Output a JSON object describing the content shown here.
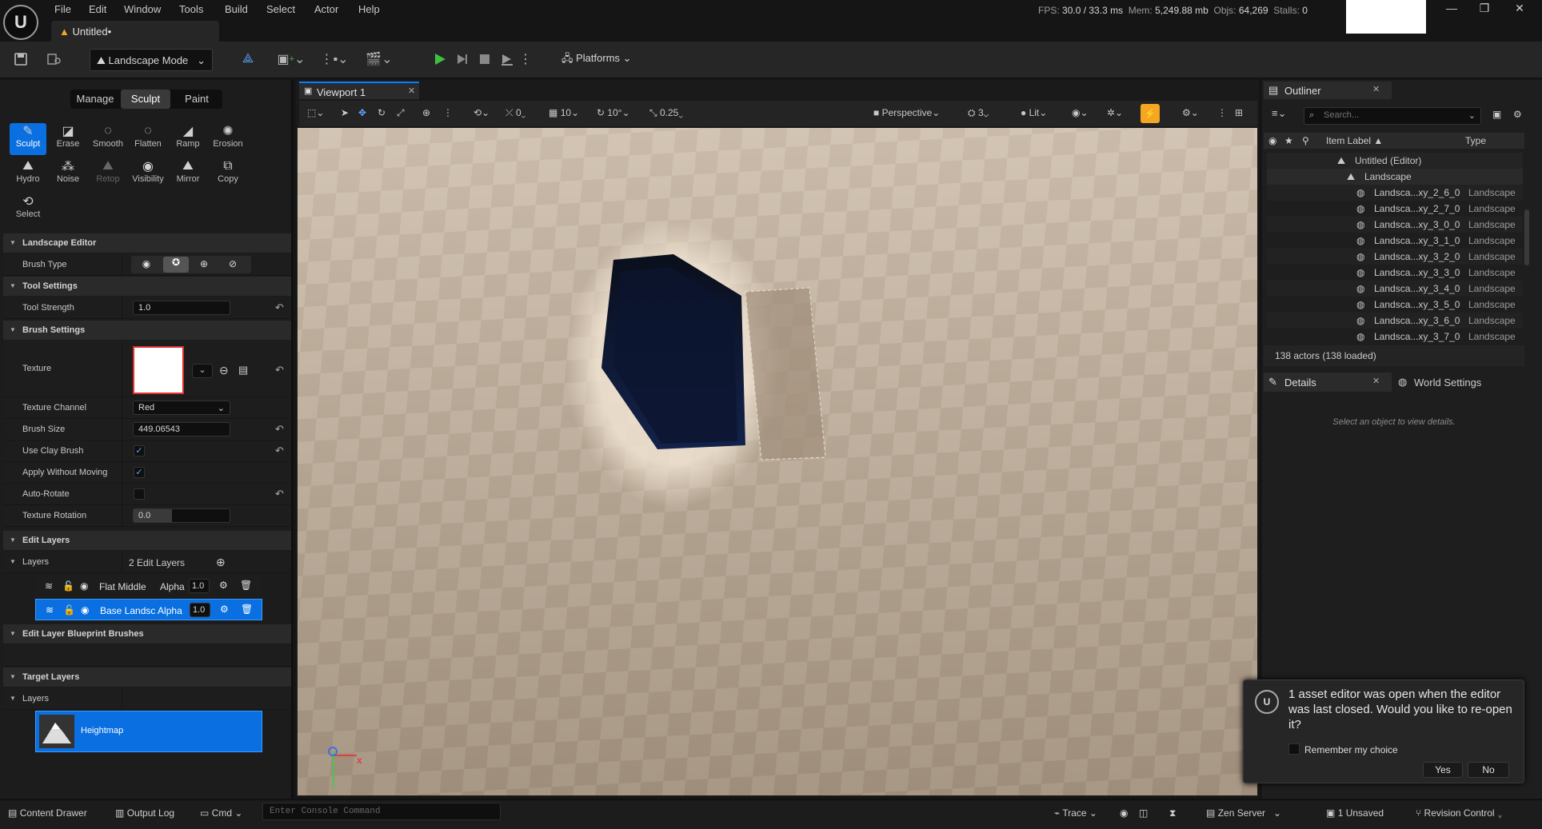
{
  "window": {
    "doc_tab": "Untitled•",
    "menu": [
      "File",
      "Edit",
      "Window",
      "Tools",
      "Build",
      "Select",
      "Actor",
      "Help"
    ],
    "stats": {
      "fps_label": "FPS:",
      "fps": "30.0",
      "ms": "/ 33.3 ms",
      "mem_label": "Mem:",
      "mem": "5,249.88 mb",
      "objs_label": "Objs:",
      "objs": "64,269",
      "stalls_label": "Stalls:",
      "stalls": "0"
    }
  },
  "toolbar": {
    "mode": "Landscape Mode",
    "platforms": "Platforms"
  },
  "left": {
    "tabs": [
      "Manage",
      "Sculpt",
      "Paint"
    ],
    "active_tab": "Sculpt",
    "tools_row1": [
      "Sculpt",
      "Erase",
      "Smooth",
      "Flatten",
      "Ramp",
      "Erosion"
    ],
    "tools_row2": [
      "Hydro",
      "Noise",
      "Retop",
      "Visibility",
      "Mirror",
      "Copy"
    ],
    "tool_select": "Select",
    "landscape_editor": "Landscape Editor",
    "brush_type": "Brush Type",
    "tool_settings": "Tool Settings",
    "tool_strength_label": "Tool Strength",
    "tool_strength": "1.0",
    "brush_settings": "Brush Settings",
    "texture_label": "Texture",
    "texture_channel_label": "Texture Channel",
    "texture_channel": "Red",
    "brush_size_label": "Brush Size",
    "brush_size": "449.06543",
    "use_clay_label": "Use Clay Brush",
    "apply_without_label": "Apply Without Moving",
    "auto_rotate_label": "Auto-Rotate",
    "texture_rotation_label": "Texture Rotation",
    "texture_rotation": "0.0",
    "edit_layers": "Edit Layers",
    "layers_label": "Layers",
    "layers_count": "2 Edit Layers",
    "layer1_name": "Flat Middle",
    "layer1_alpha_label": "Alpha",
    "layer1_alpha": "1.0",
    "layer2_name": "Base Landsc Alpha",
    "layer2_alpha": "1.0",
    "blueprint_brushes": "Edit Layer Blueprint Brushes",
    "target_layers": "Target Layers",
    "target_layers_label": "Layers",
    "heightmap": "Heightmap"
  },
  "viewport": {
    "tab": "Viewport 1",
    "rot_snap": "0",
    "grid_snap": "10",
    "angle_snap": "10°",
    "scale_snap": "0.25",
    "view_mode": "Perspective",
    "lod": "3",
    "lit": "Lit"
  },
  "outliner": {
    "tab": "Outliner",
    "search_placeholder": "Search...",
    "col_label": "Item Label ▲",
    "col_type": "Type",
    "root": "Untitled (Editor)",
    "landscape": "Landscape",
    "items": [
      {
        "label": "Landsca...xy_2_6_0",
        "type": "Landscape"
      },
      {
        "label": "Landsca...xy_2_7_0",
        "type": "Landscape"
      },
      {
        "label": "Landsca...xy_3_0_0",
        "type": "Landscape"
      },
      {
        "label": "Landsca...xy_3_1_0",
        "type": "Landscape"
      },
      {
        "label": "Landsca...xy_3_2_0",
        "type": "Landscape"
      },
      {
        "label": "Landsca...xy_3_3_0",
        "type": "Landscape"
      },
      {
        "label": "Landsca...xy_3_4_0",
        "type": "Landscape"
      },
      {
        "label": "Landsca...xy_3_5_0",
        "type": "Landscape"
      },
      {
        "label": "Landsca...xy_3_6_0",
        "type": "Landscape"
      },
      {
        "label": "Landsca...xy_3_7_0",
        "type": "Landscape"
      }
    ],
    "count": "138 actors (138 loaded)"
  },
  "details": {
    "tab": "Details",
    "world_tab": "World Settings",
    "empty": "Select an object to view details."
  },
  "notification": {
    "message": "1 asset editor was open when the editor was last closed. Would you like to re-open it?",
    "remember": "Remember my choice",
    "yes": "Yes",
    "no": "No"
  },
  "statusbar": {
    "content_drawer": "Content Drawer",
    "output_log": "Output Log",
    "cmd": "Cmd",
    "console_placeholder": "Enter Console Command",
    "trace": "Trace",
    "zen": "Zen Server",
    "unsaved": "1 Unsaved",
    "revision": "Revision Control"
  },
  "colors": {
    "accent": "#0a6fe0",
    "play": "#3fbf3f",
    "highlight": "#f5a623"
  }
}
